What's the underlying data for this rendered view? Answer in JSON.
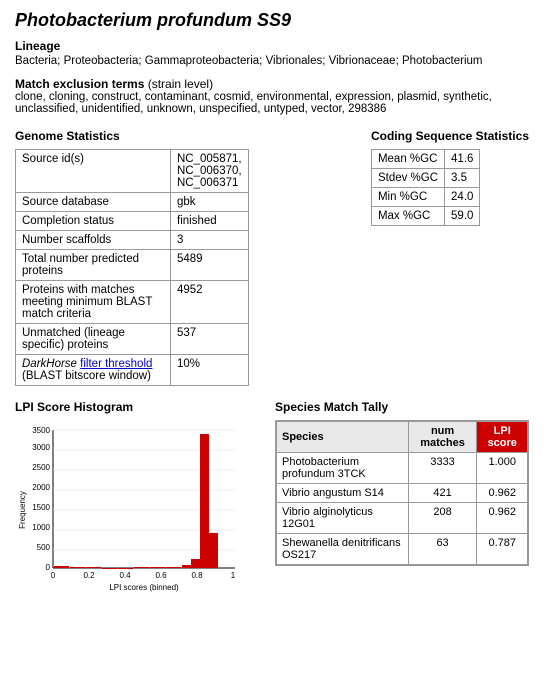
{
  "page": {
    "title": "Photobacterium profundum SS9",
    "lineage": {
      "label": "Lineage",
      "text": "Bacteria; Proteobacteria; Gammaproteobacteria; Vibrionales; Vibrionaceae; Photobacterium"
    },
    "match_exclusion": {
      "label": "Match exclusion terms",
      "sublabel": "(strain level)",
      "text": "clone, cloning, construct, contaminant, cosmid, environmental, expression, plasmid, synthetic, unclassified, unidentified, unknown, unspecified, untyped, vector, 298386"
    },
    "genome_stats": {
      "title": "Genome Statistics",
      "rows": [
        {
          "label": "Source id(s)",
          "value": "NC_005871,\nNC_006370,\nNC_006371"
        },
        {
          "label": "Source database",
          "value": "gbk"
        },
        {
          "label": "Completion status",
          "value": "finished"
        },
        {
          "label": "Number scaffolds",
          "value": "3"
        },
        {
          "label": "Total number predicted proteins",
          "value": "5489"
        },
        {
          "label": "Proteins with matches meeting minimum BLAST match criteria",
          "value": "4952"
        },
        {
          "label": "Unmatched (lineage specific) proteins",
          "value": "537"
        },
        {
          "label": "DarkHorse filter threshold (BLAST bitscore window)",
          "value": "10%",
          "has_link": true,
          "link_text": "filter threshold"
        }
      ]
    },
    "coding_stats": {
      "title": "Coding Sequence Statistics",
      "rows": [
        {
          "label": "Mean %GC",
          "value": "41.6"
        },
        {
          "label": "Stdev %GC",
          "value": "3.5"
        },
        {
          "label": "Min %GC",
          "value": "24.0"
        },
        {
          "label": "Max %GC",
          "value": "59.0"
        }
      ]
    },
    "histogram": {
      "title": "LPI Score Histogram",
      "x_label": "LPI scores (binned)",
      "y_label": "Frequency",
      "y_ticks": [
        "0",
        "500",
        "1000",
        "1500",
        "2000",
        "2500",
        "3000",
        "3500"
      ],
      "x_ticks": [
        "0",
        "0.2",
        "0.4",
        "0.6",
        "0.8",
        "1"
      ],
      "bars": [
        {
          "bin": 0.0,
          "value": 45
        },
        {
          "bin": 0.1,
          "value": 20
        },
        {
          "bin": 0.2,
          "value": 15
        },
        {
          "bin": 0.3,
          "value": 10
        },
        {
          "bin": 0.4,
          "value": 8
        },
        {
          "bin": 0.5,
          "value": 12
        },
        {
          "bin": 0.6,
          "value": 18
        },
        {
          "bin": 0.7,
          "value": 30
        },
        {
          "bin": 0.8,
          "value": 80
        },
        {
          "bin": 0.85,
          "value": 220
        },
        {
          "bin": 0.9,
          "value": 3400
        },
        {
          "bin": 0.95,
          "value": 900
        }
      ]
    },
    "species_tally": {
      "title": "Species Match Tally",
      "columns": [
        "Species",
        "num matches",
        "LPI score"
      ],
      "rows": [
        {
          "species": "Photobacterium profundum 3TCK",
          "num_matches": "3333",
          "lpi_score": "1.000"
        },
        {
          "species": "Vibrio angustum S14",
          "num_matches": "421",
          "lpi_score": "0.962"
        },
        {
          "species": "Vibrio alginolyticus 12G01",
          "num_matches": "208",
          "lpi_score": "0.962"
        },
        {
          "species": "Shewanella denitrificans OS217",
          "num_matches": "63",
          "lpi_score": "0.787"
        }
      ]
    }
  }
}
